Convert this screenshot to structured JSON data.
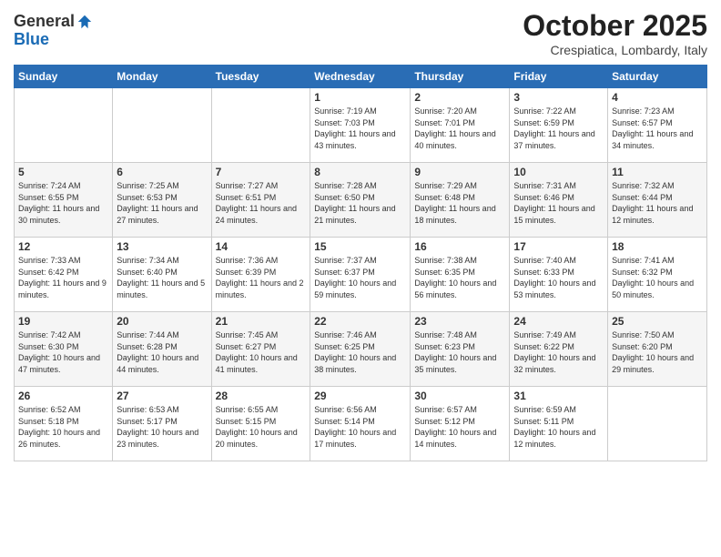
{
  "header": {
    "logo_general": "General",
    "logo_blue": "Blue",
    "month": "October 2025",
    "location": "Crespiatica, Lombardy, Italy"
  },
  "days_of_week": [
    "Sunday",
    "Monday",
    "Tuesday",
    "Wednesday",
    "Thursday",
    "Friday",
    "Saturday"
  ],
  "weeks": [
    [
      {
        "day": "",
        "info": ""
      },
      {
        "day": "",
        "info": ""
      },
      {
        "day": "",
        "info": ""
      },
      {
        "day": "1",
        "info": "Sunrise: 7:19 AM\nSunset: 7:03 PM\nDaylight: 11 hours and 43 minutes."
      },
      {
        "day": "2",
        "info": "Sunrise: 7:20 AM\nSunset: 7:01 PM\nDaylight: 11 hours and 40 minutes."
      },
      {
        "day": "3",
        "info": "Sunrise: 7:22 AM\nSunset: 6:59 PM\nDaylight: 11 hours and 37 minutes."
      },
      {
        "day": "4",
        "info": "Sunrise: 7:23 AM\nSunset: 6:57 PM\nDaylight: 11 hours and 34 minutes."
      }
    ],
    [
      {
        "day": "5",
        "info": "Sunrise: 7:24 AM\nSunset: 6:55 PM\nDaylight: 11 hours and 30 minutes."
      },
      {
        "day": "6",
        "info": "Sunrise: 7:25 AM\nSunset: 6:53 PM\nDaylight: 11 hours and 27 minutes."
      },
      {
        "day": "7",
        "info": "Sunrise: 7:27 AM\nSunset: 6:51 PM\nDaylight: 11 hours and 24 minutes."
      },
      {
        "day": "8",
        "info": "Sunrise: 7:28 AM\nSunset: 6:50 PM\nDaylight: 11 hours and 21 minutes."
      },
      {
        "day": "9",
        "info": "Sunrise: 7:29 AM\nSunset: 6:48 PM\nDaylight: 11 hours and 18 minutes."
      },
      {
        "day": "10",
        "info": "Sunrise: 7:31 AM\nSunset: 6:46 PM\nDaylight: 11 hours and 15 minutes."
      },
      {
        "day": "11",
        "info": "Sunrise: 7:32 AM\nSunset: 6:44 PM\nDaylight: 11 hours and 12 minutes."
      }
    ],
    [
      {
        "day": "12",
        "info": "Sunrise: 7:33 AM\nSunset: 6:42 PM\nDaylight: 11 hours and 9 minutes."
      },
      {
        "day": "13",
        "info": "Sunrise: 7:34 AM\nSunset: 6:40 PM\nDaylight: 11 hours and 5 minutes."
      },
      {
        "day": "14",
        "info": "Sunrise: 7:36 AM\nSunset: 6:39 PM\nDaylight: 11 hours and 2 minutes."
      },
      {
        "day": "15",
        "info": "Sunrise: 7:37 AM\nSunset: 6:37 PM\nDaylight: 10 hours and 59 minutes."
      },
      {
        "day": "16",
        "info": "Sunrise: 7:38 AM\nSunset: 6:35 PM\nDaylight: 10 hours and 56 minutes."
      },
      {
        "day": "17",
        "info": "Sunrise: 7:40 AM\nSunset: 6:33 PM\nDaylight: 10 hours and 53 minutes."
      },
      {
        "day": "18",
        "info": "Sunrise: 7:41 AM\nSunset: 6:32 PM\nDaylight: 10 hours and 50 minutes."
      }
    ],
    [
      {
        "day": "19",
        "info": "Sunrise: 7:42 AM\nSunset: 6:30 PM\nDaylight: 10 hours and 47 minutes."
      },
      {
        "day": "20",
        "info": "Sunrise: 7:44 AM\nSunset: 6:28 PM\nDaylight: 10 hours and 44 minutes."
      },
      {
        "day": "21",
        "info": "Sunrise: 7:45 AM\nSunset: 6:27 PM\nDaylight: 10 hours and 41 minutes."
      },
      {
        "day": "22",
        "info": "Sunrise: 7:46 AM\nSunset: 6:25 PM\nDaylight: 10 hours and 38 minutes."
      },
      {
        "day": "23",
        "info": "Sunrise: 7:48 AM\nSunset: 6:23 PM\nDaylight: 10 hours and 35 minutes."
      },
      {
        "day": "24",
        "info": "Sunrise: 7:49 AM\nSunset: 6:22 PM\nDaylight: 10 hours and 32 minutes."
      },
      {
        "day": "25",
        "info": "Sunrise: 7:50 AM\nSunset: 6:20 PM\nDaylight: 10 hours and 29 minutes."
      }
    ],
    [
      {
        "day": "26",
        "info": "Sunrise: 6:52 AM\nSunset: 5:18 PM\nDaylight: 10 hours and 26 minutes."
      },
      {
        "day": "27",
        "info": "Sunrise: 6:53 AM\nSunset: 5:17 PM\nDaylight: 10 hours and 23 minutes."
      },
      {
        "day": "28",
        "info": "Sunrise: 6:55 AM\nSunset: 5:15 PM\nDaylight: 10 hours and 20 minutes."
      },
      {
        "day": "29",
        "info": "Sunrise: 6:56 AM\nSunset: 5:14 PM\nDaylight: 10 hours and 17 minutes."
      },
      {
        "day": "30",
        "info": "Sunrise: 6:57 AM\nSunset: 5:12 PM\nDaylight: 10 hours and 14 minutes."
      },
      {
        "day": "31",
        "info": "Sunrise: 6:59 AM\nSunset: 5:11 PM\nDaylight: 10 hours and 12 minutes."
      },
      {
        "day": "",
        "info": ""
      }
    ]
  ]
}
